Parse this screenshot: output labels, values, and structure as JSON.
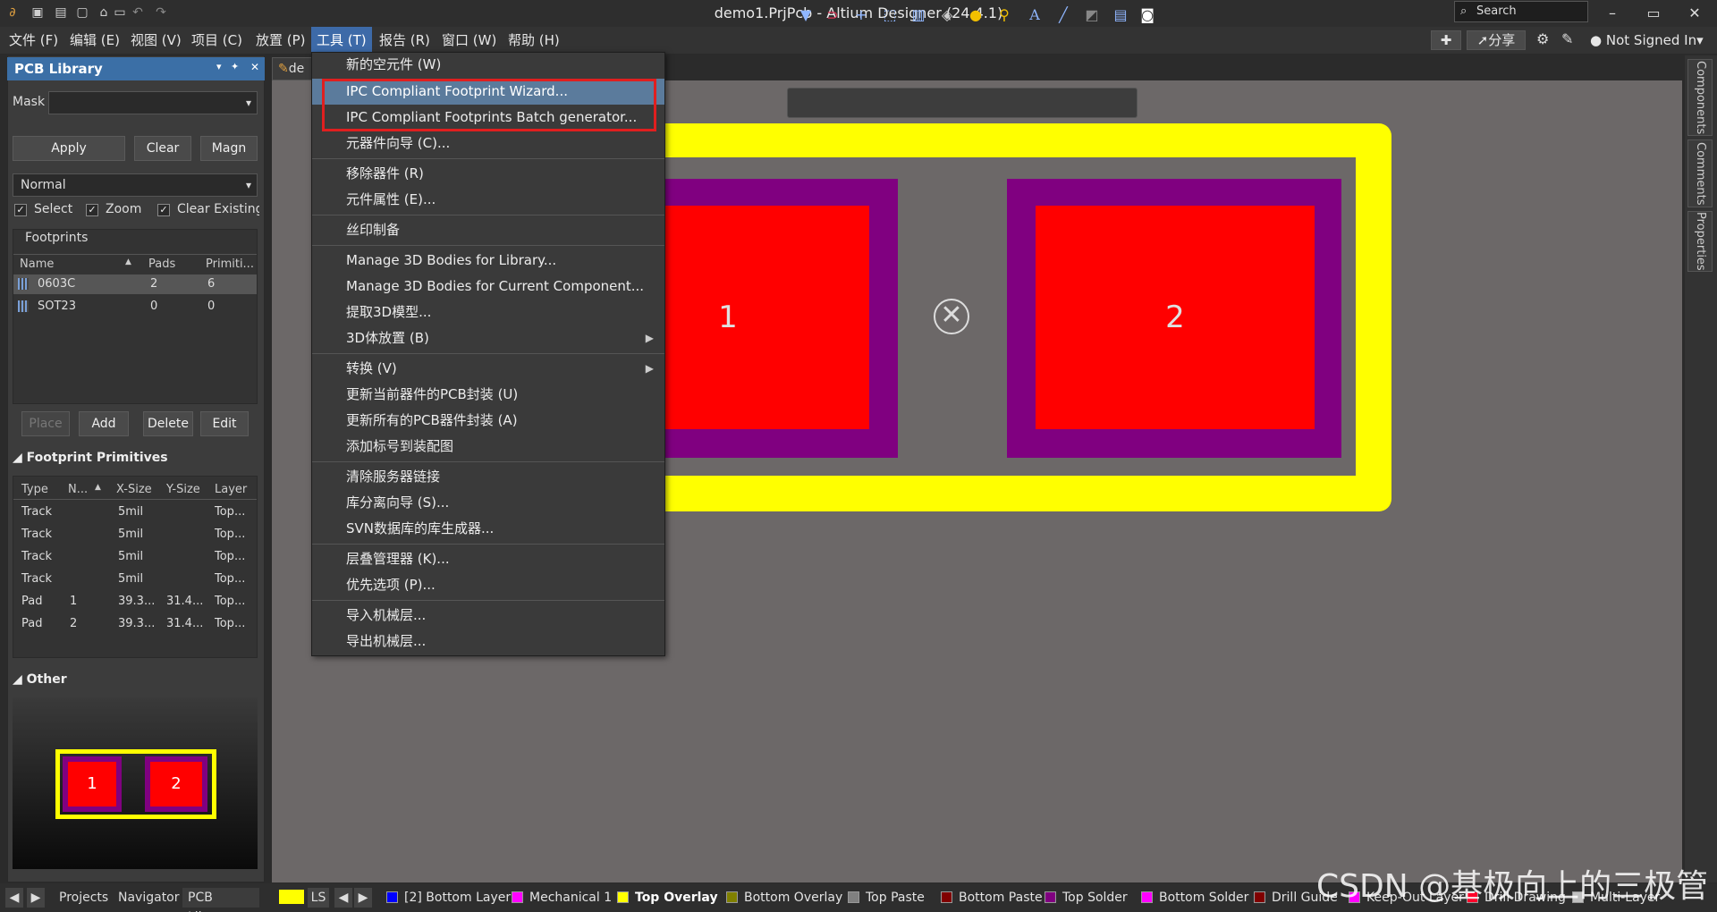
{
  "window": {
    "title": "demo1.PrjPcb - Altium Designer (24.4.1)",
    "search_placeholder": "Search",
    "minimize": "–",
    "maximize": "▭",
    "close": "✕"
  },
  "menu": [
    "文件 (F)",
    "编辑 (E)",
    "视图 (V)",
    "项目 (C)",
    "放置 (P)",
    "工具 (T)",
    "报告 (R)",
    "窗口 (W)",
    "帮助 (H)"
  ],
  "right_toolbar": {
    "share": "分享",
    "account": "Not Signed In"
  },
  "panel": {
    "title": "PCB Library",
    "mask_label": "Mask",
    "apply": "Apply",
    "clear": "Clear",
    "magnify": "Magn",
    "mode": "Normal",
    "select": "Select",
    "zoom": "Zoom",
    "clear_existing": "Clear Existing",
    "footprints_label": "Footprints",
    "footprint_cols": [
      "Name",
      "Pads",
      "Primiti..."
    ],
    "footprints": [
      {
        "name": "0603C",
        "pads": "2",
        "prims": "6"
      },
      {
        "name": "SOT23",
        "pads": "0",
        "prims": "0"
      }
    ],
    "place": "Place",
    "add": "Add",
    "delete": "Delete",
    "edit": "Edit",
    "primitives_label": "Footprint Primitives",
    "prim_cols": [
      "Type",
      "N...",
      "X-Size",
      "Y-Size",
      "Layer"
    ],
    "primitives": [
      {
        "type": "Track",
        "n": "",
        "x": "5mil",
        "y": "",
        "layer": "Top..."
      },
      {
        "type": "Track",
        "n": "",
        "x": "5mil",
        "y": "",
        "layer": "Top..."
      },
      {
        "type": "Track",
        "n": "",
        "x": "5mil",
        "y": "",
        "layer": "Top..."
      },
      {
        "type": "Track",
        "n": "",
        "x": "5mil",
        "y": "",
        "layer": "Top..."
      },
      {
        "type": "Pad",
        "n": "1",
        "x": "39.3...",
        "y": "31.4...",
        "layer": "Top..."
      },
      {
        "type": "Pad",
        "n": "2",
        "x": "39.3...",
        "y": "31.4...",
        "layer": "Top..."
      }
    ],
    "other_label": "Other",
    "preview_pads": [
      "1",
      "2"
    ]
  },
  "doc_tab": "de",
  "canvas": {
    "pad1": "1",
    "pad2": "2"
  },
  "right_tabs": [
    "Components",
    "Comments",
    "Properties"
  ],
  "tools_menu": [
    {
      "label": "新的空元件 (W)"
    },
    {
      "label": "IPC Compliant Footprint Wizard...",
      "highlighted": true
    },
    {
      "label": "IPC Compliant Footprints Batch generator..."
    },
    {
      "label": "元器件向导 (C)..."
    },
    {
      "label": "移除器件 (R)"
    },
    {
      "label": "元件属性 (E)..."
    },
    {
      "label": "丝印制备"
    },
    {
      "label": "Manage 3D Bodies for Library..."
    },
    {
      "label": "Manage 3D Bodies for Current Component..."
    },
    {
      "label": "提取3D模型..."
    },
    {
      "label": "3D体放置 (B)",
      "submenu": true
    },
    {
      "label": "转换 (V)",
      "submenu": true
    },
    {
      "label": "更新当前器件的PCB封装 (U)"
    },
    {
      "label": "更新所有的PCB器件封装 (A)"
    },
    {
      "label": "添加标号到装配图"
    },
    {
      "label": "清除服务器链接"
    },
    {
      "label": "库分离向导 (S)..."
    },
    {
      "label": "SVN数据库的库生成器..."
    },
    {
      "label": "层叠管理器 (K)..."
    },
    {
      "label": "优先选项 (P)..."
    },
    {
      "label": "导入机械层..."
    },
    {
      "label": "导出机械层..."
    }
  ],
  "bottom_tabs": [
    "Projects",
    "Navigator",
    "PCB Library"
  ],
  "ls": "LS",
  "layers": [
    {
      "name": "[2] Bottom Layer",
      "color": "#0000ff"
    },
    {
      "name": "Mechanical 1",
      "color": "#ff00ff"
    },
    {
      "name": "Top Overlay",
      "color": "#ffff00",
      "active": true
    },
    {
      "name": "Bottom Overlay",
      "color": "#808000"
    },
    {
      "name": "Top Paste",
      "color": "#808080"
    },
    {
      "name": "Bottom Paste",
      "color": "#800000"
    },
    {
      "name": "Top Solder",
      "color": "#800080"
    },
    {
      "name": "Bottom Solder",
      "color": "#ff00ff"
    },
    {
      "name": "Drill Guide",
      "color": "#800000"
    },
    {
      "name": "Keep-Out Layer",
      "color": "#ff00ff"
    },
    {
      "name": "Drill Drawing",
      "color": "#ff002a"
    },
    {
      "name": "Multi-Layer",
      "color": "#c0c0c0"
    }
  ],
  "watermark": "CSDN @基极向上的三极管",
  "colors": {
    "overlay": "#ffff00",
    "solder": "#800080",
    "pad": "#ff0000",
    "canvas": "#6c6868",
    "accent": "#3b6fa6"
  }
}
